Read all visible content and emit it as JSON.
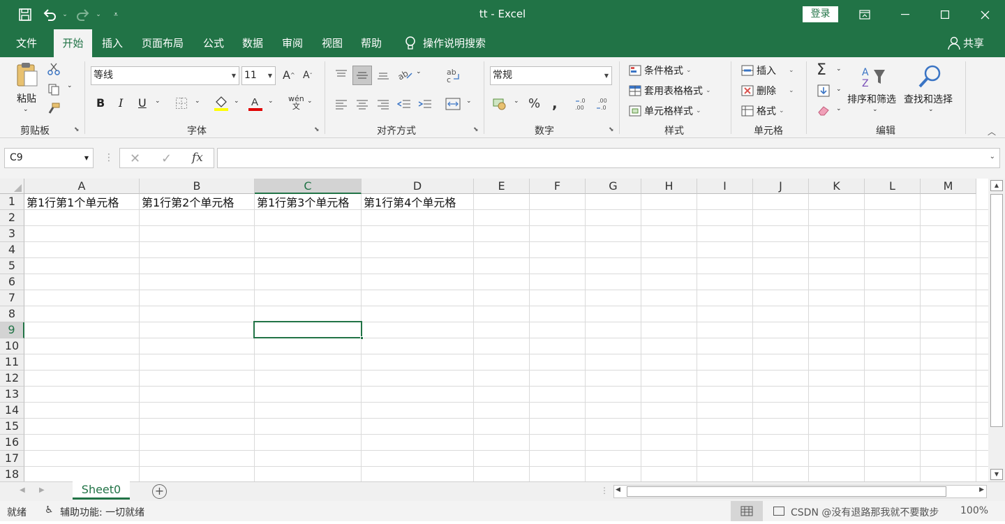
{
  "titlebar": {
    "title": "tt  -  Excel",
    "login": "登录",
    "save_icon": "save-icon",
    "undo_icon": "undo-icon",
    "redo_icon": "redo-icon"
  },
  "tabs": [
    {
      "label": "文件",
      "active": false
    },
    {
      "label": "开始",
      "active": true
    },
    {
      "label": "插入",
      "active": false
    },
    {
      "label": "页面布局",
      "active": false
    },
    {
      "label": "公式",
      "active": false
    },
    {
      "label": "数据",
      "active": false
    },
    {
      "label": "审阅",
      "active": false
    },
    {
      "label": "视图",
      "active": false
    },
    {
      "label": "帮助",
      "active": false
    }
  ],
  "tell_me": "操作说明搜索",
  "share": "共享",
  "ribbon": {
    "clipboard": {
      "paste": "粘贴",
      "label": "剪贴板"
    },
    "font": {
      "name": "等线",
      "size": "11",
      "label": "字体",
      "bold": "B",
      "italic": "I",
      "underline": "U"
    },
    "alignment": {
      "label": "对齐方式"
    },
    "number": {
      "format": "常规",
      "label": "数字"
    },
    "styles": {
      "conditional": "条件格式",
      "table": "套用表格格式",
      "cell": "单元格样式",
      "label": "样式"
    },
    "cells": {
      "insert": "插入",
      "delete": "删除",
      "format": "格式",
      "label": "单元格"
    },
    "editing": {
      "sort": "排序和筛选",
      "find": "查找和选择",
      "label": "编辑"
    }
  },
  "formula_bar": {
    "namebox": "C9",
    "formula": ""
  },
  "columns": [
    "A",
    "B",
    "C",
    "D",
    "E",
    "F",
    "G",
    "H",
    "I",
    "J",
    "K",
    "L",
    "M"
  ],
  "rows": [
    "1",
    "2",
    "3",
    "4",
    "5",
    "6",
    "7",
    "8",
    "9",
    "10",
    "11",
    "12",
    "13",
    "14",
    "15",
    "16",
    "17",
    "18"
  ],
  "cells": [
    {
      "ref": "A1",
      "value": "第1行第1个单元格"
    },
    {
      "ref": "B1",
      "value": "第1行第2个单元格"
    },
    {
      "ref": "C1",
      "value": "第1行第3个单元格"
    },
    {
      "ref": "D1",
      "value": "第1行第4个单元格"
    }
  ],
  "selected_cell": "C9",
  "sheets": [
    {
      "name": "Sheet0",
      "active": true
    }
  ],
  "status": {
    "ready": "就绪",
    "accessibility": "辅助功能: 一切就绪",
    "watermark": "CSDN @没有退路那我就不要散步",
    "zoom": "100%"
  },
  "colors": {
    "accent": "#217346",
    "ribbon_bg": "#f3f3f3"
  }
}
